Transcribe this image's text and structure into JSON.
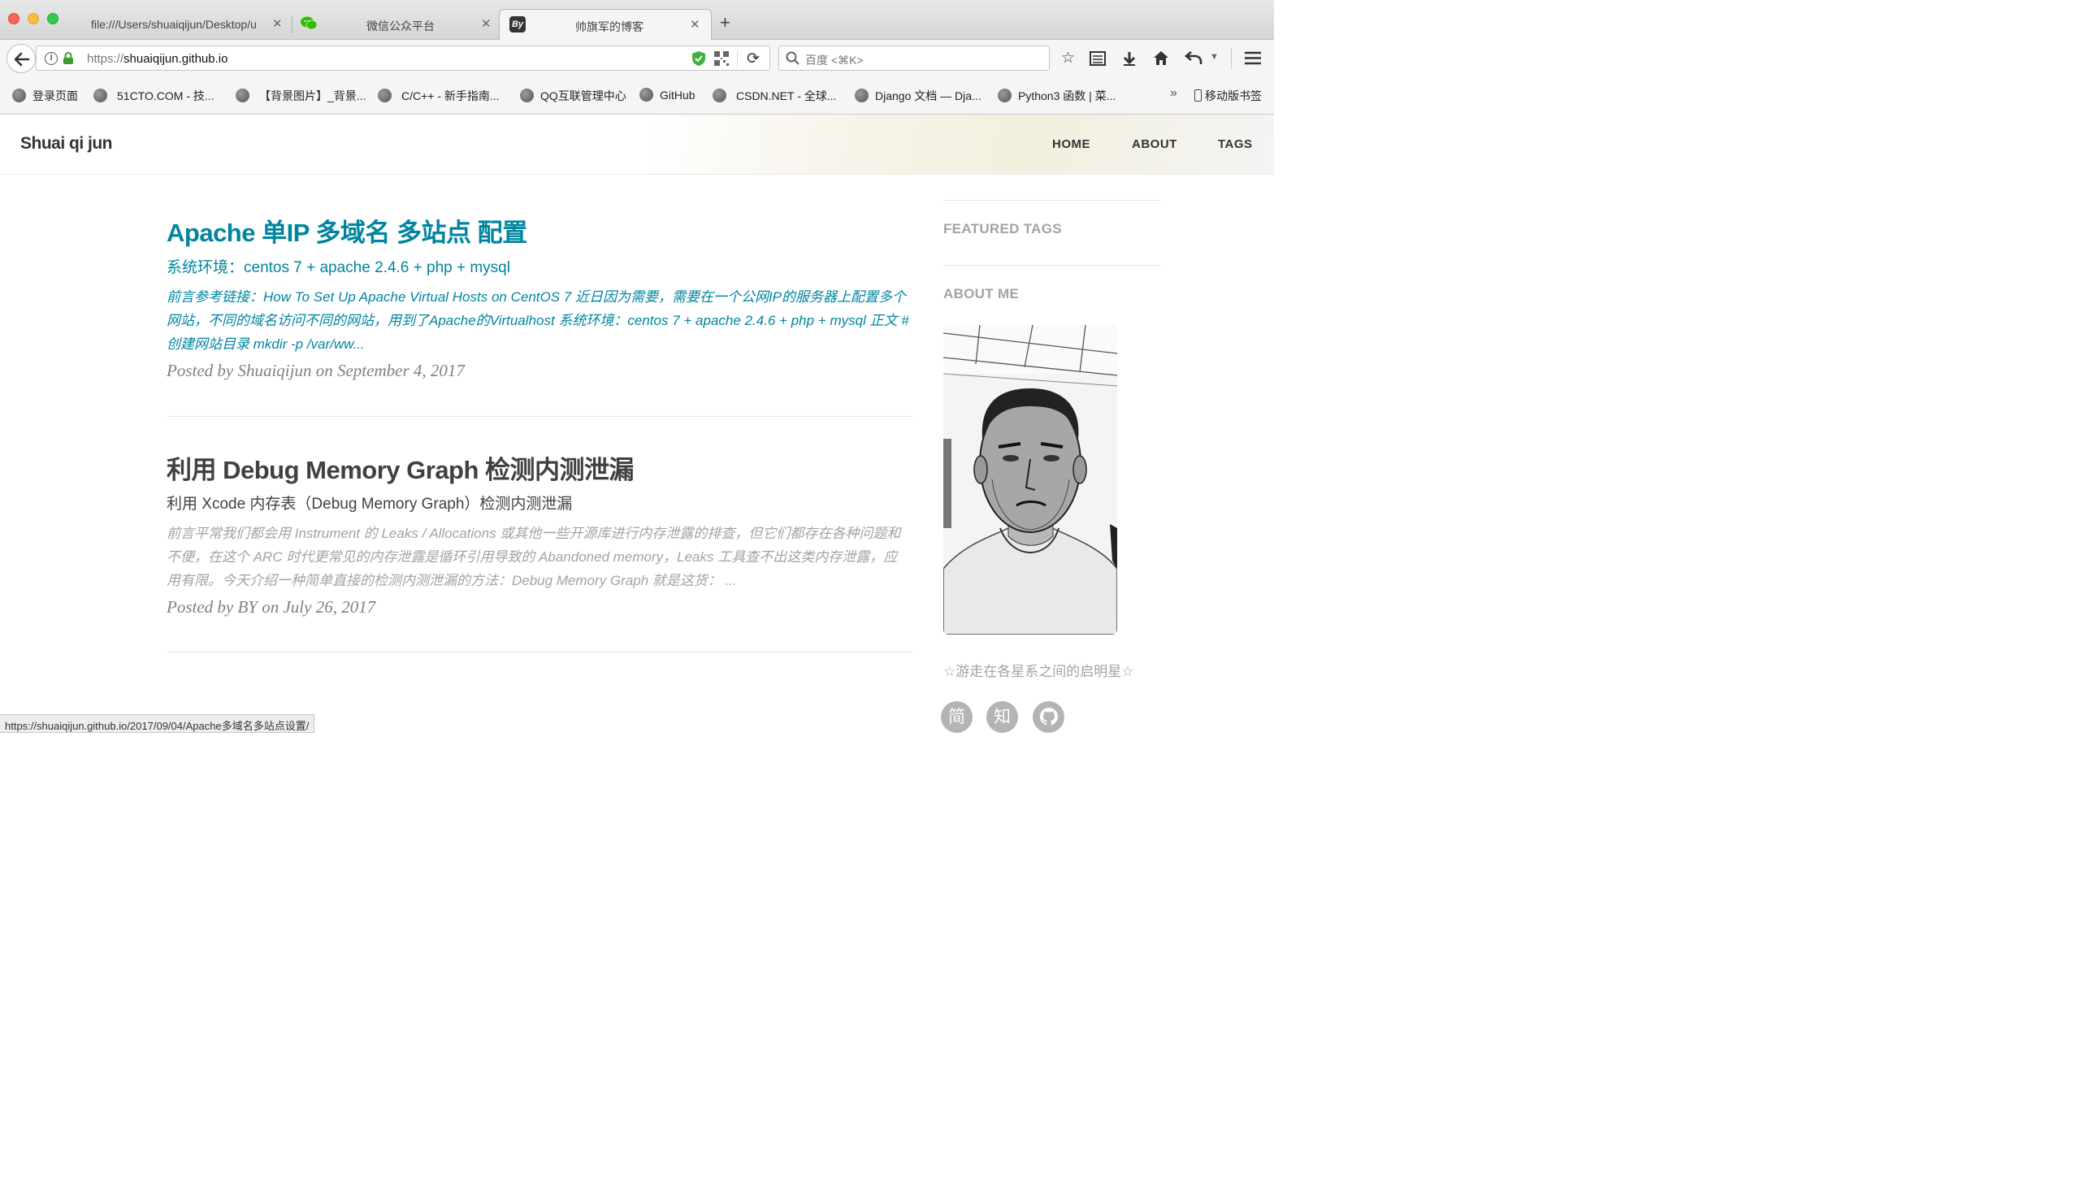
{
  "browser": {
    "tabs": [
      {
        "title": "file:///Users/shuaiqijun/Desktop/u",
        "icon": "file-icon"
      },
      {
        "title": "微信公众平台",
        "icon": "wechat-icon"
      },
      {
        "title": "帅旗军的博客",
        "icon": "blog-icon",
        "active": true
      }
    ],
    "new_tab_label": "+",
    "url_scheme": "https://",
    "url_host": "shuaiqijun.github.io",
    "search_placeholder": "百度 <⌘K>",
    "bookmarks": [
      "登录页面",
      "51CTO.COM - 技...",
      "【背景图片】_背景...",
      "C/C++ - 新手指南...",
      "QQ互联管理中心",
      "GitHub",
      "CSDN.NET - 全球...",
      "Django 文档 — Dja...",
      "Python3 函数 | 菜..."
    ],
    "mobile_bookmarks": "移动版书签",
    "status_url": "https://shuaiqijun.github.io/2017/09/04/Apache多域名多站点设置/"
  },
  "site": {
    "brand": "Shuai qi jun",
    "nav": [
      "HOME",
      "ABOUT",
      "TAGS"
    ]
  },
  "posts": [
    {
      "title": "Apache 单IP 多域名 多站点 配置",
      "subtitle": "系统环境：centos 7 + apache 2.4.6 + php + mysql",
      "excerpt": "前言参考链接：How To Set Up Apache Virtual Hosts on CentOS 7 近日因为需要，需要在一个公网IP的服务器上配置多个网站，不同的域名访问不同的网站，用到了Apache的Virtualhost 系统环境：centos 7 + apache 2.4.6 + php + mysql 正文 # 创建网站目录 mkdir -p /var/ww...",
      "meta": "Posted by Shuaiqijun on September 4, 2017",
      "hovered": true
    },
    {
      "title": "利用 Debug Memory Graph 检测内测泄漏",
      "subtitle": "利用 Xcode 内存表（Debug Memory Graph）检测内测泄漏",
      "excerpt": "前言平常我们都会用 Instrument 的 Leaks / Allocations 或其他一些开源库进行内存泄露的排查，但它们都存在各种问题和不便，在这个 ARC 时代更常见的内存泄露是循环引用导致的 Abandoned memory，Leaks 工具查不出这类内存泄露，应用有限。今天介绍一种简单直接的检测内测泄漏的方法：Debug Memory Graph 就是这货： ...",
      "meta": "Posted by BY on July 26, 2017",
      "hovered": false
    }
  ],
  "sidebar": {
    "featured_tags_title": "FEATURED TAGS",
    "about_title": "ABOUT ME",
    "motto": "☆游走在各星系之间的启明星☆",
    "social": [
      {
        "label": "简",
        "icon": "jianshu-icon"
      },
      {
        "label": "知",
        "icon": "zhihu-icon"
      },
      {
        "label": "",
        "icon": "github-icon"
      }
    ]
  },
  "colors": {
    "link": "#0085a1",
    "text": "#404040",
    "muted": "#a3a3a3",
    "secure": "#3a9a2f"
  }
}
